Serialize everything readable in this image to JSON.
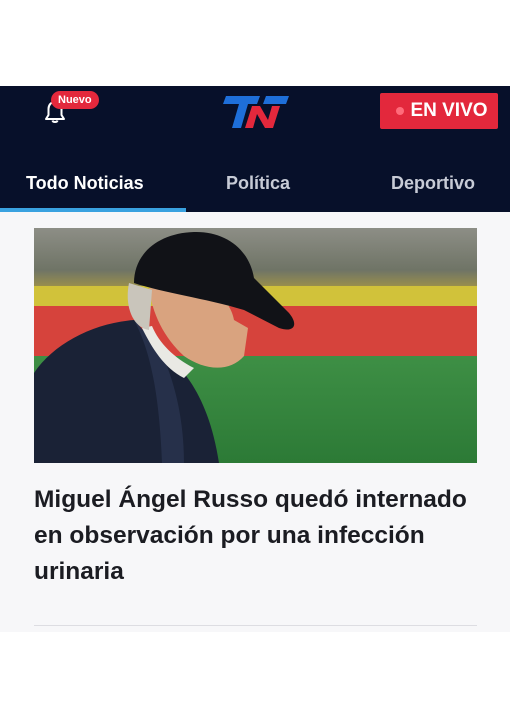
{
  "header": {
    "notifications": {
      "icon": "bell-icon",
      "badge": "Nuevo"
    },
    "logo": {
      "text": "TN"
    },
    "live_button": {
      "label": "EN VIVO"
    }
  },
  "tabs": [
    {
      "label": "Todo Noticias",
      "active": true
    },
    {
      "label": "Política",
      "active": false
    },
    {
      "label": "Deportivo",
      "active": false
    }
  ],
  "article": {
    "headline": "Miguel Ángel Russo quedó internado en observación por una infección urinaria",
    "image": "photo-older-man-in-black-cap-at-stadium"
  },
  "colors": {
    "header_bg": "#07102a",
    "accent_red": "#e3283c",
    "tab_indicator": "#3aa2e0",
    "logo_blue": "#1e6fd9",
    "logo_red": "#e3283c"
  }
}
